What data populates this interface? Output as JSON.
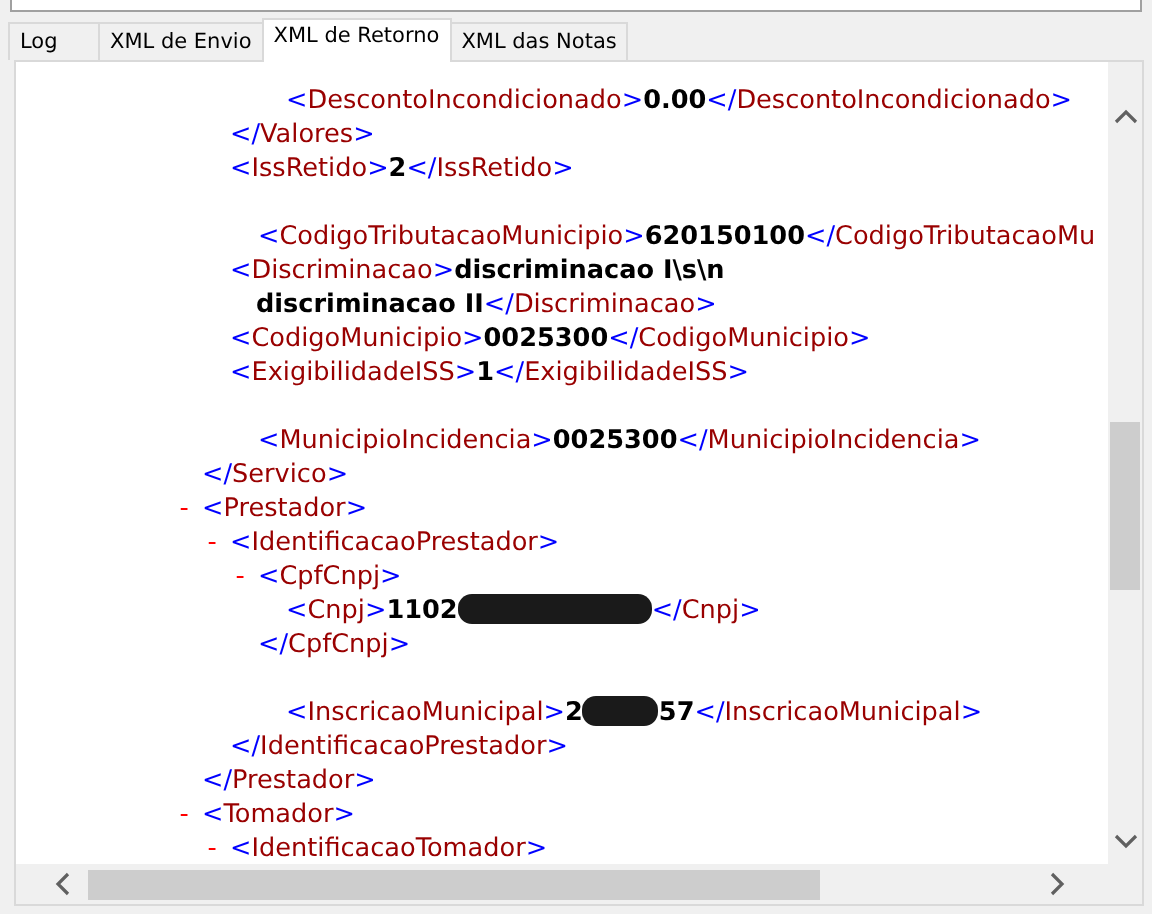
{
  "tabs": [
    {
      "label": "Log",
      "selected": false
    },
    {
      "label": "XML de Envio",
      "selected": false
    },
    {
      "label": "XML de Retorno",
      "selected": true
    },
    {
      "label": "XML das Notas",
      "selected": false
    }
  ],
  "xml": [
    {
      "close_tag": {
        "start": "</",
        "name": "Servico",
        "end": ">"
      },
      "children": [
        {
          "close_tag": {
            "start": "</",
            "name": "Valores",
            "end": ">"
          },
          "children": [
            {
              "open_tag": {
                "start": "<",
                "name": "DescontoIncondicionado",
                "end": ">"
              },
              "value": [
                "0.00"
              ],
              "close_tag": {
                "start": "</",
                "name": "DescontoIncondicionado",
                "end": ">"
              },
              "shifted": true
            }
          ]
        },
        {
          "open_tag": {
            "start": "<",
            "name": "IssRetido",
            "end": ">"
          },
          "value": [
            "2"
          ],
          "close_tag": {
            "start": "</",
            "name": "IssRetido",
            "end": ">"
          }
        },
        {
          "open_tag": {
            "start": "<",
            "name": "CodigoTributacaoMunicipio",
            "end": ">"
          },
          "value": [
            "620150100"
          ],
          "close_tag": {
            "start": "</",
            "name": "CodigoTributacaoMu"
          },
          "gap_before": true,
          "shifted": true
        },
        {
          "open_tag": {
            "start": "<",
            "name": "Discriminacao",
            "end": ">"
          },
          "value": [
            "discriminacao I\\s\\n",
            "discriminacao II"
          ],
          "close_tag": {
            "start": "</",
            "name": "Discriminacao",
            "end": ">"
          }
        },
        {
          "open_tag": {
            "start": "<",
            "name": "CodigoMunicipio",
            "end": ">"
          },
          "value": [
            "0025300"
          ],
          "close_tag": {
            "start": "</",
            "name": "CodigoMunicipio",
            "end": ">"
          }
        },
        {
          "open_tag": {
            "start": "<",
            "name": "ExigibilidadeISS",
            "end": ">"
          },
          "value": [
            "1"
          ],
          "close_tag": {
            "start": "</",
            "name": "ExigibilidadeISS",
            "end": ">"
          }
        },
        {
          "open_tag": {
            "start": "<",
            "name": "MunicipioIncidencia",
            "end": ">"
          },
          "value": [
            "0025300"
          ],
          "close_tag": {
            "start": "</",
            "name": "MunicipioIncidencia",
            "end": ">"
          },
          "gap_before": true,
          "shifted": true
        }
      ]
    },
    {
      "open_tag": {
        "start": "<",
        "name": "Prestador",
        "end": ">"
      },
      "toggle": "-",
      "close_tag": {
        "start": "</",
        "name": "Prestador",
        "end": ">"
      },
      "children": [
        {
          "open_tag": {
            "start": "<",
            "name": "IdentificacaoPrestador",
            "end": ">"
          },
          "toggle": "-",
          "close_tag": {
            "start": "</",
            "name": "IdentificacaoPrestador",
            "end": ">"
          },
          "children": [
            {
              "open_tag": {
                "start": "<",
                "name": "CpfCnpj",
                "end": ">"
              },
              "toggle": "-",
              "close_tag": {
                "start": "</",
                "name": "CpfCnpj",
                "end": ">"
              },
              "children": [
                {
                  "open_tag": {
                    "start": "<",
                    "name": "Cnpj",
                    "end": ">"
                  },
                  "value": [
                    "1102"
                  ],
                  "redacted": true,
                  "close_tag": {
                    "start": "</",
                    "name": "Cnpj",
                    "end": ">"
                  }
                }
              ]
            },
            {
              "open_tag": {
                "start": "<",
                "name": "InscricaoMunicipal",
                "end": ">"
              },
              "value": [
                "2"
              ],
              "redacted": true,
              "value_after": "57",
              "close_tag": {
                "start": "</",
                "name": "InscricaoMunicipal",
                "end": ">"
              },
              "gap_before": true,
              "shifted": true
            }
          ]
        }
      ]
    },
    {
      "open_tag": {
        "start": "<",
        "name": "Tomador",
        "end": ">"
      },
      "toggle": "-",
      "children": [
        {
          "open_tag": {
            "start": "<",
            "name": "IdentificacaoTomador",
            "end": ">"
          },
          "toggle": "-"
        }
      ]
    }
  ]
}
